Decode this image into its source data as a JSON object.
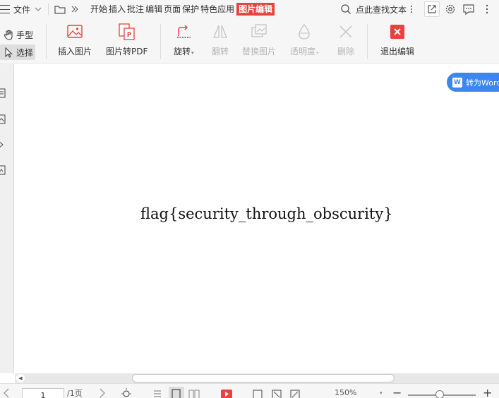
{
  "menubar": {
    "file_label": "文件",
    "tabs": [
      "开始",
      "插入",
      "批注",
      "编辑",
      "页面",
      "保护",
      "特色应用"
    ],
    "active_tab": "图片编辑",
    "search_label": "点此查找文本"
  },
  "toolbar": {
    "hand_label": "手型",
    "select_label": "选择",
    "insert_image_label": "插入图片",
    "image_to_pdf_label": "图片转PDF",
    "rotate_label": "旋转",
    "flip_label": "翻转",
    "replace_image_label": "替换图片",
    "transparency_label": "透明度",
    "delete_label": "删除",
    "exit_edit_label": "退出编辑"
  },
  "document": {
    "flag_text": "flag{security_through_obscurity}"
  },
  "convert_button": {
    "label": "转为Word"
  },
  "statusbar": {
    "page_current": "1",
    "page_total": "/1页",
    "zoom": "150%",
    "zoom_fraction": 0.47
  },
  "colors": {
    "accent_red": "#e8423f",
    "convert_blue": "#3d86f0"
  },
  "icons": [
    "menu-icon",
    "chevron-down-icon",
    "folder-icon",
    "double-chevron-icon",
    "search-icon",
    "more-vertical-icon",
    "share-icon",
    "gear-icon",
    "message-icon",
    "hand-icon",
    "cursor-icon",
    "image-icon",
    "image-pdf-icon",
    "rotate-icon",
    "flip-icon",
    "replace-image-icon",
    "drop-icon",
    "delete-x-icon",
    "exit-icon"
  ]
}
